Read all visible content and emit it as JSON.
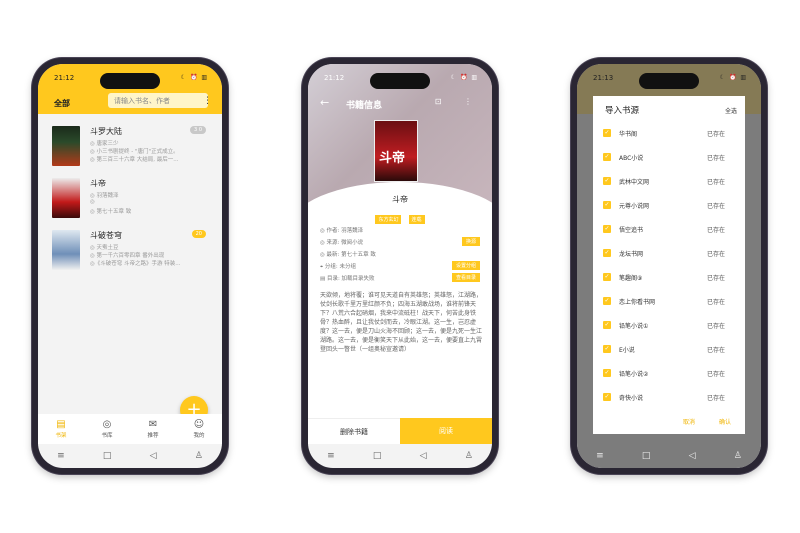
{
  "colors": {
    "accent": "#ffc81e",
    "badge_gray": "#c8c8c8"
  },
  "phone1": {
    "time": "21:12",
    "status_icons": "☾ ⏰ ▥",
    "header": {
      "filter": "全部",
      "search_placeholder": "请输入书名、作者"
    },
    "books": [
      {
        "title": "斗罗大陆",
        "line1": "◎ 唐家三少",
        "line2": "◎ 小三书剧提终 - \"唐门\"正式成立。",
        "line3": "◎ 第三百三十六章 大结局, 最后一...",
        "badge": "3 0"
      },
      {
        "title": "斗帝",
        "line1": "◎ 羽落魏泽",
        "line2": "◎",
        "line3": "◎ 第七十五章 致",
        "badge": ""
      },
      {
        "title": "斗破苍穹",
        "line1": "◎ 天蚕土豆",
        "line2": "◎ 第一千六百零四章 番外出现",
        "line3": "◎《斗破苍穹 斗帝之路》手游 特装...",
        "badge": "20"
      }
    ],
    "fab": "+",
    "tabs": [
      {
        "label": "书架",
        "icon": "▤"
      },
      {
        "label": "书库",
        "icon": "◎"
      },
      {
        "label": "推荐",
        "icon": "✉"
      },
      {
        "label": "我的",
        "icon": "☺"
      }
    ]
  },
  "phone2": {
    "time": "21:12",
    "status_icons": "☾ ⏰ ▥",
    "title": "书籍信息",
    "back": "←",
    "actions": "⊡ ⋮",
    "cover_text": "斗帝",
    "book_name": "斗帝",
    "chips": [
      "东方玄幻",
      "连载"
    ],
    "info": [
      {
        "text": "◎ 作者: 羽落魏泽",
        "btn": ""
      },
      {
        "text": "◎ 来源: 微阅小说",
        "btn": "换源"
      },
      {
        "text": "◎ 最新: 第七十五章 致",
        "btn": ""
      },
      {
        "text": "⌖ 分组: 未分组",
        "btn": "设置分组"
      },
      {
        "text": "▤ 目录: 加载目录失败",
        "btn": "查看目录"
      }
    ],
    "intro": "天欲倾，地将覆；谁可见天道自有英雄怒；英雄怒，江湖路，仗剑长歌千里万里红颜不负；四海五湖敢战场，谁将前锋天下？八荒六合起硝烟，我来中流砥柱！战天下，何苦此身铁骨？热血醉，且让我仗剑而去，冷眼江湖。这一生，岂忍虚度？这一去，便是刀山火海不回顾；这一去，便是九死一生江湖路。这一去，便是衡笑天下从此始，这一去，便要直上九霄登回头一瞥世（一组奥秘宣邀请）",
    "delete_label": "删除书籍",
    "read_label": "阅读"
  },
  "phone3": {
    "time": "21:13",
    "status_icons": "☾ ⏰ ▥",
    "dialog_title": "导入书源",
    "select_all": "全选",
    "sources": [
      {
        "name": "华书阁",
        "status": "已存在"
      },
      {
        "name": "ABC小说",
        "status": "已存在"
      },
      {
        "name": "武林中文网",
        "status": "已存在"
      },
      {
        "name": "元尊小说网",
        "status": "已存在"
      },
      {
        "name": "悟空追书",
        "status": "已存在"
      },
      {
        "name": "龙坛书网",
        "status": "已存在"
      },
      {
        "name": "笔趣阁⑨",
        "status": "已存在"
      },
      {
        "name": "恋上你看书网",
        "status": "已存在"
      },
      {
        "name": "铅笔小说①",
        "status": "已存在"
      },
      {
        "name": "E小说",
        "status": "已存在"
      },
      {
        "name": "铅笔小说②",
        "status": "已存在"
      },
      {
        "name": "奇快小说",
        "status": "已存在"
      }
    ],
    "cancel": "取消",
    "ok": "确认"
  },
  "nav": {
    "menu": "≡",
    "home": "□",
    "back": "◁",
    "person": "♙"
  }
}
